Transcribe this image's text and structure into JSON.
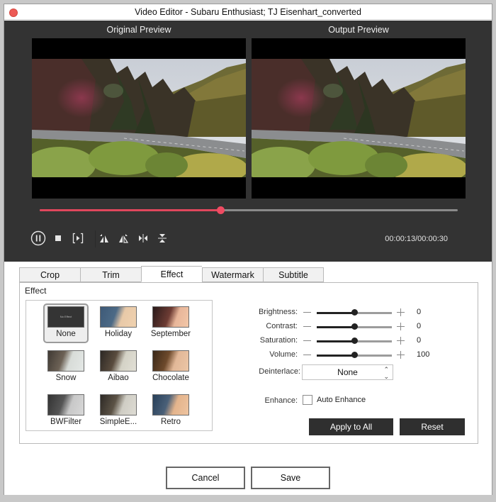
{
  "window": {
    "title": "Video Editor - Subaru Enthusiast; TJ Eisenhart_converted"
  },
  "preview": {
    "original_label": "Original Preview",
    "output_label": "Output Preview"
  },
  "playback": {
    "progress_fraction": 0.433,
    "timecode": "00:00:13/00:00:30",
    "controls": [
      "pause",
      "stop",
      "trim-play",
      "rotate-left",
      "rotate-right",
      "flip-horizontal",
      "flip-vertical"
    ]
  },
  "tabs": [
    {
      "label": "Crop",
      "active": false
    },
    {
      "label": "Trim",
      "active": false
    },
    {
      "label": "Effect",
      "active": true
    },
    {
      "label": "Watermark",
      "active": false
    },
    {
      "label": "Subtitle",
      "active": false
    }
  ],
  "effect_panel": {
    "title": "Effect",
    "none_thumb_text": "No Effect",
    "effects": [
      {
        "label": "None",
        "selected": true
      },
      {
        "label": "Holiday",
        "selected": false
      },
      {
        "label": "September",
        "selected": false
      },
      {
        "label": "Snow",
        "selected": false
      },
      {
        "label": "Aibao",
        "selected": false
      },
      {
        "label": "Chocolate",
        "selected": false
      },
      {
        "label": "BWFilter",
        "selected": false
      },
      {
        "label": "SimpleE...",
        "selected": false
      },
      {
        "label": "Retro",
        "selected": false
      }
    ],
    "adjustments": [
      {
        "label": "Brightness:",
        "value": "0",
        "fraction": 0.5
      },
      {
        "label": "Contrast:",
        "value": "0",
        "fraction": 0.5
      },
      {
        "label": "Saturation:",
        "value": "0",
        "fraction": 0.5
      },
      {
        "label": "Volume:",
        "value": "100",
        "fraction": 0.5
      }
    ],
    "deinterlace": {
      "label": "Deinterlace:",
      "value": "None"
    },
    "enhance": {
      "label": "Enhance:",
      "checkbox_label": "Auto Enhance",
      "checked": false
    },
    "apply_all_label": "Apply to All",
    "reset_label": "Reset"
  },
  "footer": {
    "cancel_label": "Cancel",
    "save_label": "Save"
  },
  "colors": {
    "accent": "#ef4b62",
    "dark_bg": "#333333",
    "close": "#ed5a55"
  }
}
